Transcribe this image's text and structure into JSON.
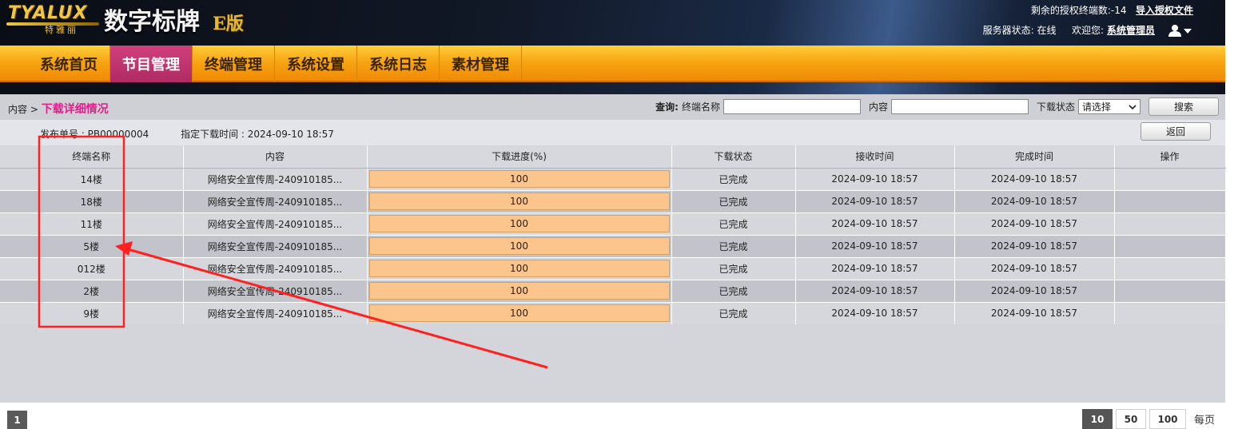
{
  "header": {
    "logo_brand": "TYALUX",
    "logo_sub": "特雅丽",
    "logo_title": "数字标牌",
    "logo_edition": "E版",
    "license_text": "剩余的授权终端数:-14",
    "import_license": "导入授权文件",
    "server_status": "服务器状态: 在线",
    "welcome": "欢迎您:",
    "username": "系统管理员"
  },
  "nav": {
    "items": [
      "系统首页",
      "节目管理",
      "终端管理",
      "系统设置",
      "系统日志",
      "素材管理"
    ],
    "active_index": 1
  },
  "toolbar": {
    "crumb_prefix": "内容 >",
    "crumb_current": "下载详细情况",
    "query_label": "查询:",
    "terminal_label": "终端名称",
    "content_label": "内容",
    "status_label": "下载状态",
    "status_value": "请选择",
    "search_button": "搜索"
  },
  "info": {
    "publish_no": "发布单号 : PB00000004",
    "download_time": "指定下载时间 : 2024-09-10 18:57",
    "back_button": "返回"
  },
  "table": {
    "columns": [
      "终端名称",
      "内容",
      "下载进度(%)",
      "下载状态",
      "接收时间",
      "完成时间",
      "操作"
    ],
    "rows": [
      {
        "terminal": "14楼",
        "content": "网络安全宣传周-240910185...",
        "progress": "100",
        "status": "已完成",
        "received": "2024-09-10 18:57",
        "finished": "2024-09-10 18:57",
        "action": ""
      },
      {
        "terminal": "18楼",
        "content": "网络安全宣传周-240910185...",
        "progress": "100",
        "status": "已完成",
        "received": "2024-09-10 18:57",
        "finished": "2024-09-10 18:57",
        "action": ""
      },
      {
        "terminal": "11楼",
        "content": "网络安全宣传周-240910185...",
        "progress": "100",
        "status": "已完成",
        "received": "2024-09-10 18:57",
        "finished": "2024-09-10 18:57",
        "action": ""
      },
      {
        "terminal": "5楼",
        "content": "网络安全宣传周-240910185...",
        "progress": "100",
        "status": "已完成",
        "received": "2024-09-10 18:57",
        "finished": "2024-09-10 18:57",
        "action": ""
      },
      {
        "terminal": "012楼",
        "content": "网络安全宣传周-240910185...",
        "progress": "100",
        "status": "已完成",
        "received": "2024-09-10 18:57",
        "finished": "2024-09-10 18:57",
        "action": ""
      },
      {
        "terminal": "2楼",
        "content": "网络安全宣传周-240910185...",
        "progress": "100",
        "status": "已完成",
        "received": "2024-09-10 18:57",
        "finished": "2024-09-10 18:57",
        "action": ""
      },
      {
        "terminal": "9楼",
        "content": "网络安全宣传周-240910185...",
        "progress": "100",
        "status": "已完成",
        "received": "2024-09-10 18:57",
        "finished": "2024-09-10 18:57",
        "action": ""
      }
    ]
  },
  "pager": {
    "current_page": "1",
    "page_sizes": [
      "10",
      "50",
      "100"
    ],
    "active_size_index": 0,
    "per_page_label": "每页"
  },
  "colors": {
    "nav_active": "#c0346f",
    "crumb_highlight": "#e0208a",
    "progress_fill": "#fdc58e",
    "annotation": "#ff2020"
  }
}
